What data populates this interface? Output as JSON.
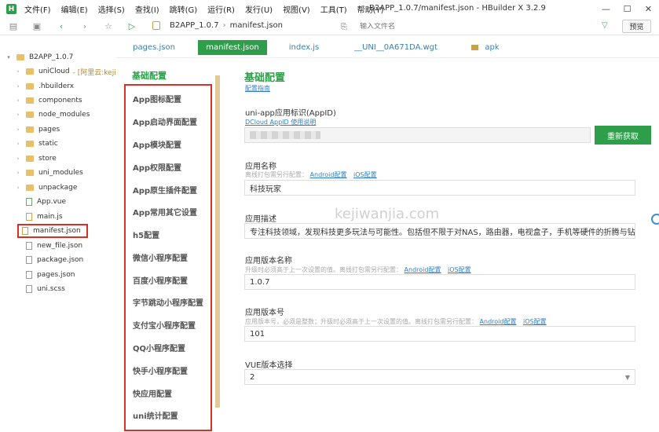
{
  "app": {
    "logo_text": "H",
    "window_title": "B2APP_1.0.7/manifest.json - HBuilder X 3.2.9",
    "menu": [
      "文件(F)",
      "编辑(E)",
      "选择(S)",
      "查找(I)",
      "跳转(G)",
      "运行(R)",
      "发行(U)",
      "视图(V)",
      "工具(T)",
      "帮助(Y)"
    ]
  },
  "toolbar": {
    "breadcrumb": [
      "B2APP_1.0.7",
      "manifest.json"
    ],
    "search_placeholder": "输入文件名",
    "preview_label": "预览"
  },
  "tree": {
    "items": [
      {
        "label": "B2APP_1.0.7",
        "type": "root",
        "expanded": true
      },
      {
        "label": "uniCloud",
        "extra": "- [阿里云:kejiw",
        "type": "folder"
      },
      {
        "label": ".hbuilderx",
        "type": "folder"
      },
      {
        "label": "components",
        "type": "folder"
      },
      {
        "label": "node_modules",
        "type": "folder"
      },
      {
        "label": "pages",
        "type": "folder"
      },
      {
        "label": "static",
        "type": "folder"
      },
      {
        "label": "store",
        "type": "folder"
      },
      {
        "label": "uni_modules",
        "type": "folder"
      },
      {
        "label": "unpackage",
        "type": "folder"
      },
      {
        "label": "App.vue",
        "type": "vue"
      },
      {
        "label": "main.js",
        "type": "js"
      },
      {
        "label": "manifest.json",
        "type": "json",
        "selected": true
      },
      {
        "label": "new_file.json",
        "type": "json"
      },
      {
        "label": "package.json",
        "type": "json"
      },
      {
        "label": "pages.json",
        "type": "json"
      },
      {
        "label": "uni.scss",
        "type": "scss"
      }
    ]
  },
  "tabs": [
    {
      "label": "pages.json"
    },
    {
      "label": "manifest.json",
      "active": true
    },
    {
      "label": "index.js"
    },
    {
      "label": "__UNI__0A671DA.wgt"
    },
    {
      "label": "apk",
      "folder": true
    }
  ],
  "config_nav": {
    "heading": "基础配置",
    "items": [
      "App图标配置",
      "App启动界面配置",
      "App模块配置",
      "App权限配置",
      "App原生插件配置",
      "App常用其它设置",
      "h5配置",
      "微信小程序配置",
      "百度小程序配置",
      "字节跳动小程序配置",
      "支付宝小程序配置",
      "QQ小程序配置",
      "快手小程序配置",
      "快应用配置",
      "uni统计配置"
    ]
  },
  "form": {
    "title": "基础配置",
    "guide_link": "配置指南",
    "appid": {
      "label": "uni-app应用标识(AppID)",
      "help_link": "DCloud AppID 使用说明",
      "button": "重新获取"
    },
    "name": {
      "label": "应用名称",
      "hint": "离线打包需另行配置：",
      "android_link": "Android配置",
      "ios_link": "iOS配置",
      "value": "科技玩家"
    },
    "desc": {
      "label": "应用描述",
      "value": "专注科技领域，发现科技更多玩法与可能性。包括但不限于对NAS，路由器，电视盒子，手机等硬件的折腾与钻研。"
    },
    "version_name": {
      "label": "应用版本名称",
      "hint": "升级时必须高于上一次设置的值。离线打包需另行配置：",
      "android_link": "Android配置",
      "ios_link": "iOS配置",
      "value": "1.0.7"
    },
    "version_code": {
      "label": "应用版本号",
      "hint": "应用版本号，必须是整数；升级时必须高于上一次设置的值。离线打包需另行配置：",
      "android_link": "Android配置",
      "ios_link": "iOS配置",
      "value": "101"
    },
    "vue": {
      "label": "VUE版本选择",
      "value": "2"
    }
  },
  "watermark": "kejiwanjia.com"
}
